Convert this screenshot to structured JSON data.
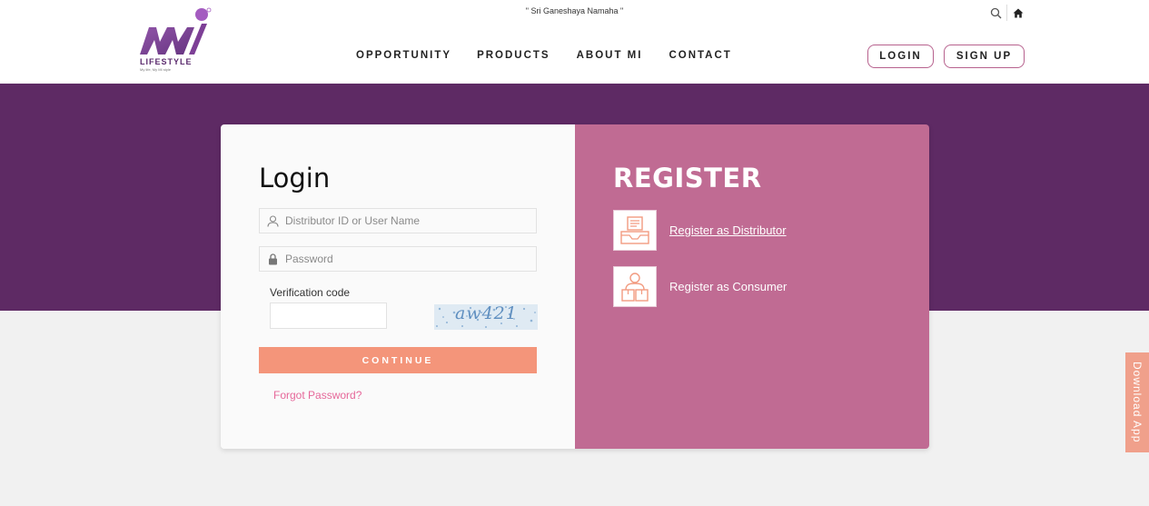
{
  "header": {
    "tagline": "\" Sri Ganeshaya Namaha \"",
    "logo_sub": "LIFESTYLE",
    "logo_tiny": "My life, My MI style",
    "nav": [
      "OPPORTUNITY",
      "PRODUCTS",
      "ABOUT MI",
      "CONTACT"
    ],
    "login_label": "LOGIN",
    "signup_label": "SIGN UP",
    "icons": [
      "search-icon",
      "home-icon"
    ]
  },
  "login": {
    "title": "Login",
    "user_placeholder": "Distributor ID or User Name",
    "password_placeholder": "Password",
    "verification_label": "Verification code",
    "captcha_text": "aw421",
    "continue_label": "CONTINUE",
    "forgot_label": "Forgot Password?"
  },
  "register": {
    "title": "REGISTER",
    "distributor_label": "Register as Distributor",
    "consumer_label": "Register as Consumer"
  },
  "download_app": "Download App",
  "colors": {
    "brand_purple": "#5e2a64",
    "register_pink": "#c06b93",
    "continue_orange": "#f4957a",
    "forgot_pink": "#e6689a",
    "outline_border": "#b7628e"
  }
}
